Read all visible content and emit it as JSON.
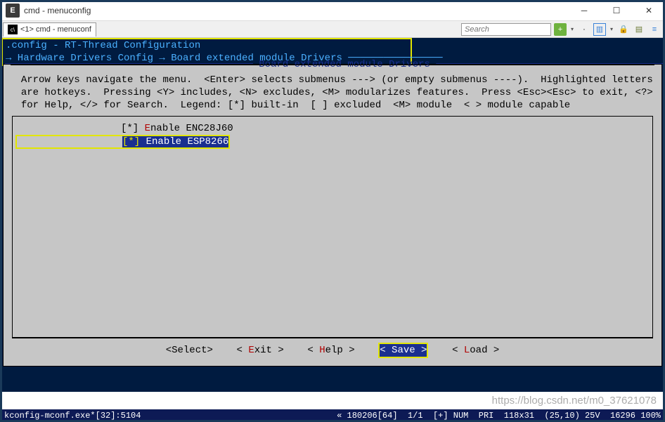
{
  "window": {
    "title": "cmd - menuconfig",
    "app_badge": "E"
  },
  "tabbar": {
    "tab_index": "<1>",
    "tab_label": "cmd - menuconf",
    "search_placeholder": "Search"
  },
  "config": {
    "header_line": ".config - RT-Thread Configuration",
    "breadcrumb": "→ Hardware Drivers Config → Board extended module Drivers ────────────────",
    "panel_title": " Board extended module Drivers ",
    "help": "  Arrow keys navigate the menu.  <Enter> selects submenus ---> (or empty submenus ----).  Highlighted letters\n  are hotkeys.  Pressing <Y> includes, <N> excludes, <M> modularizes features.  Press <Esc><Esc> to exit, <?>\n  for Help, </> for Search.  Legend: [*] built-in  [ ] excluded  <M> module  < > module capable"
  },
  "options": [
    {
      "state": "[*]",
      "hotkey": "E",
      "label_rest": "nable ENC28J60",
      "selected": false
    },
    {
      "state": "[*]",
      "hotkey": "E",
      "label_rest": "nable ESP8266",
      "selected": true
    }
  ],
  "actions": {
    "select": "<Select>",
    "exit_pre": "< ",
    "exit_hk": "E",
    "exit_post": "xit >",
    "help_pre": "< ",
    "help_hk": "H",
    "help_post": "elp >",
    "save_pre": "< ",
    "save_hk": "S",
    "save_post": "ave >",
    "load_pre": "< ",
    "load_hk": "L",
    "load_post": "oad >"
  },
  "status": {
    "left": "kconfig-mconf.exe*[32]:5104",
    "right": "« 180206[64]  1/1  [+] NUM  PRI  118x31  (25,10) 25V  16296 100%"
  },
  "watermark": "https://blog.csdn.net/m0_37621078"
}
